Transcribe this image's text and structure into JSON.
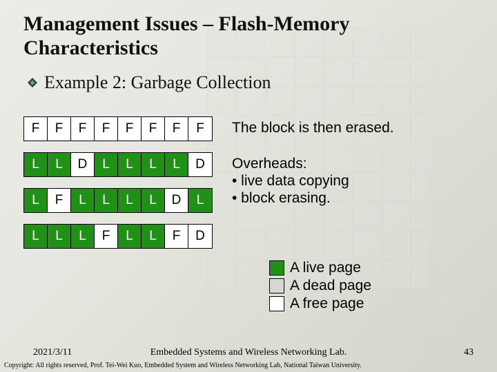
{
  "title": "Management Issues – Flash-Memory Characteristics",
  "subtitle": "Example 2: Garbage Collection",
  "rows": [
    {
      "cells": [
        "F",
        "F",
        "F",
        "F",
        "F",
        "F",
        "F",
        "F"
      ],
      "classes": [
        "free",
        "free",
        "free",
        "free",
        "free",
        "free",
        "free",
        "free"
      ],
      "text_lines": [
        "The block is then erased."
      ]
    },
    {
      "cells": [
        "L",
        "L",
        "D",
        "L",
        "L",
        "L",
        "L",
        "D"
      ],
      "classes": [
        "live",
        "live",
        "dead",
        "live",
        "live",
        "live",
        "live",
        "dead"
      ],
      "text_lines": [
        "Overheads:",
        "• live data copying",
        "• block erasing."
      ]
    },
    {
      "cells": [
        "L",
        "F",
        "L",
        "L",
        "L",
        "L",
        "D",
        "L"
      ],
      "classes": [
        "live",
        "free",
        "live",
        "live",
        "live",
        "live",
        "dead",
        "live"
      ],
      "text_lines": []
    },
    {
      "cells": [
        "L",
        "L",
        "L",
        "F",
        "L",
        "L",
        "F",
        "D"
      ],
      "classes": [
        "live",
        "live",
        "live",
        "free",
        "live",
        "live",
        "free",
        "dead"
      ],
      "text_lines": []
    }
  ],
  "legend": [
    {
      "label": "A live page",
      "cls": "live"
    },
    {
      "label": "A dead page",
      "cls": "dead"
    },
    {
      "label": "A free page",
      "cls": "free"
    }
  ],
  "footer": {
    "date": "2021/3/11",
    "center": "Embedded Systems and Wireless Networking Lab.",
    "page": "43",
    "copyright": "Copyright: All rights reserved, Prof. Tei-Wei Kuo, Embedded System and Wireless Networking Lab, National Taiwan University."
  }
}
